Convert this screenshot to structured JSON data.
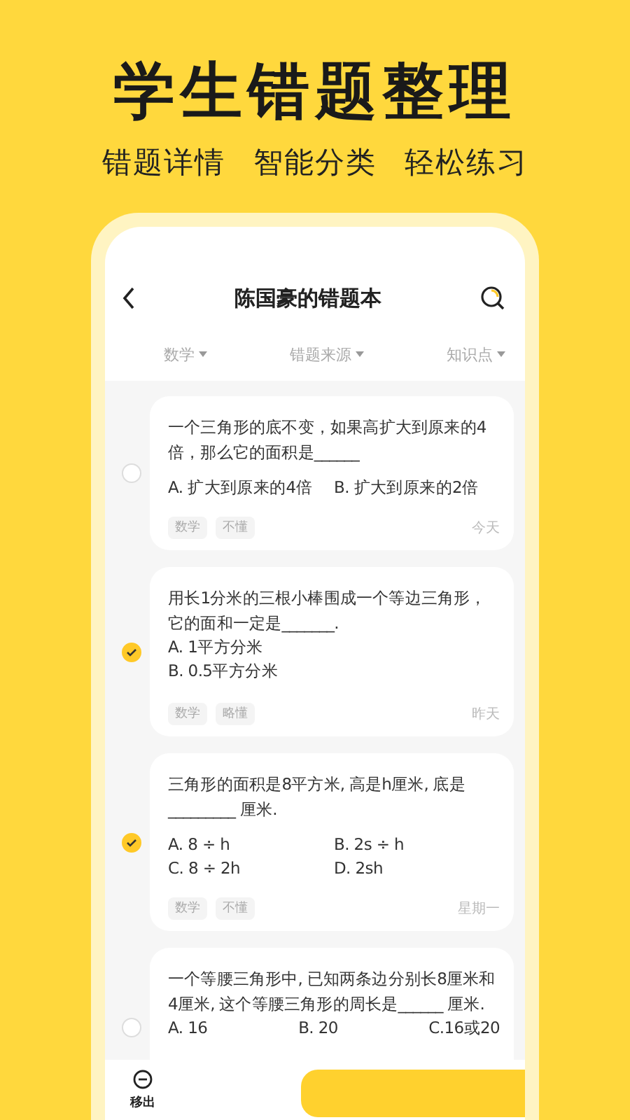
{
  "headline": "学生错题整理",
  "features": [
    "错题详情",
    "智能分类",
    "轻松练习"
  ],
  "phone": {
    "title": "陈国豪的错题本",
    "filters": [
      {
        "label": "数学"
      },
      {
        "label": "错题来源"
      },
      {
        "label": "知识点"
      }
    ],
    "questions": [
      {
        "selected": false,
        "kind": "grid2",
        "text": "一个三角形的底不变，如果高扩大到原来的4倍，那么它的面积是______",
        "options": [
          "A. 扩大到原来的4倍",
          "B. 扩大到原来的2倍"
        ],
        "tags": [
          "数学",
          "不懂"
        ],
        "date": "今天"
      },
      {
        "selected": true,
        "kind": "list",
        "text": "用长1分米的三根小棒围成一个等边三角形，它的面和一定是_______.",
        "options": [
          "A. 1平方分米",
          "B. 0.5平方分米"
        ],
        "tags": [
          "数学",
          "略懂"
        ],
        "date": "昨天"
      },
      {
        "selected": true,
        "kind": "grid2",
        "text": "三角形的面积是8平方米, 高是h厘米, 底是_________ 厘米.",
        "options": [
          "A. 8 ÷ h",
          "B. 2s ÷ h",
          "C. 8 ÷ 2h",
          "D. 2sh"
        ],
        "tags": [
          "数学",
          "不懂"
        ],
        "date": "星期一"
      },
      {
        "selected": false,
        "kind": "row3",
        "text": "一个等腰三角形中, 已知两条边分别长8厘米和4厘米, 这个等腰三角形的周长是______ 厘米.",
        "options": [
          "A. 16",
          "B. 20",
          "C.16或20"
        ]
      }
    ],
    "bottom_bar": {
      "remove_label": "移出"
    }
  }
}
